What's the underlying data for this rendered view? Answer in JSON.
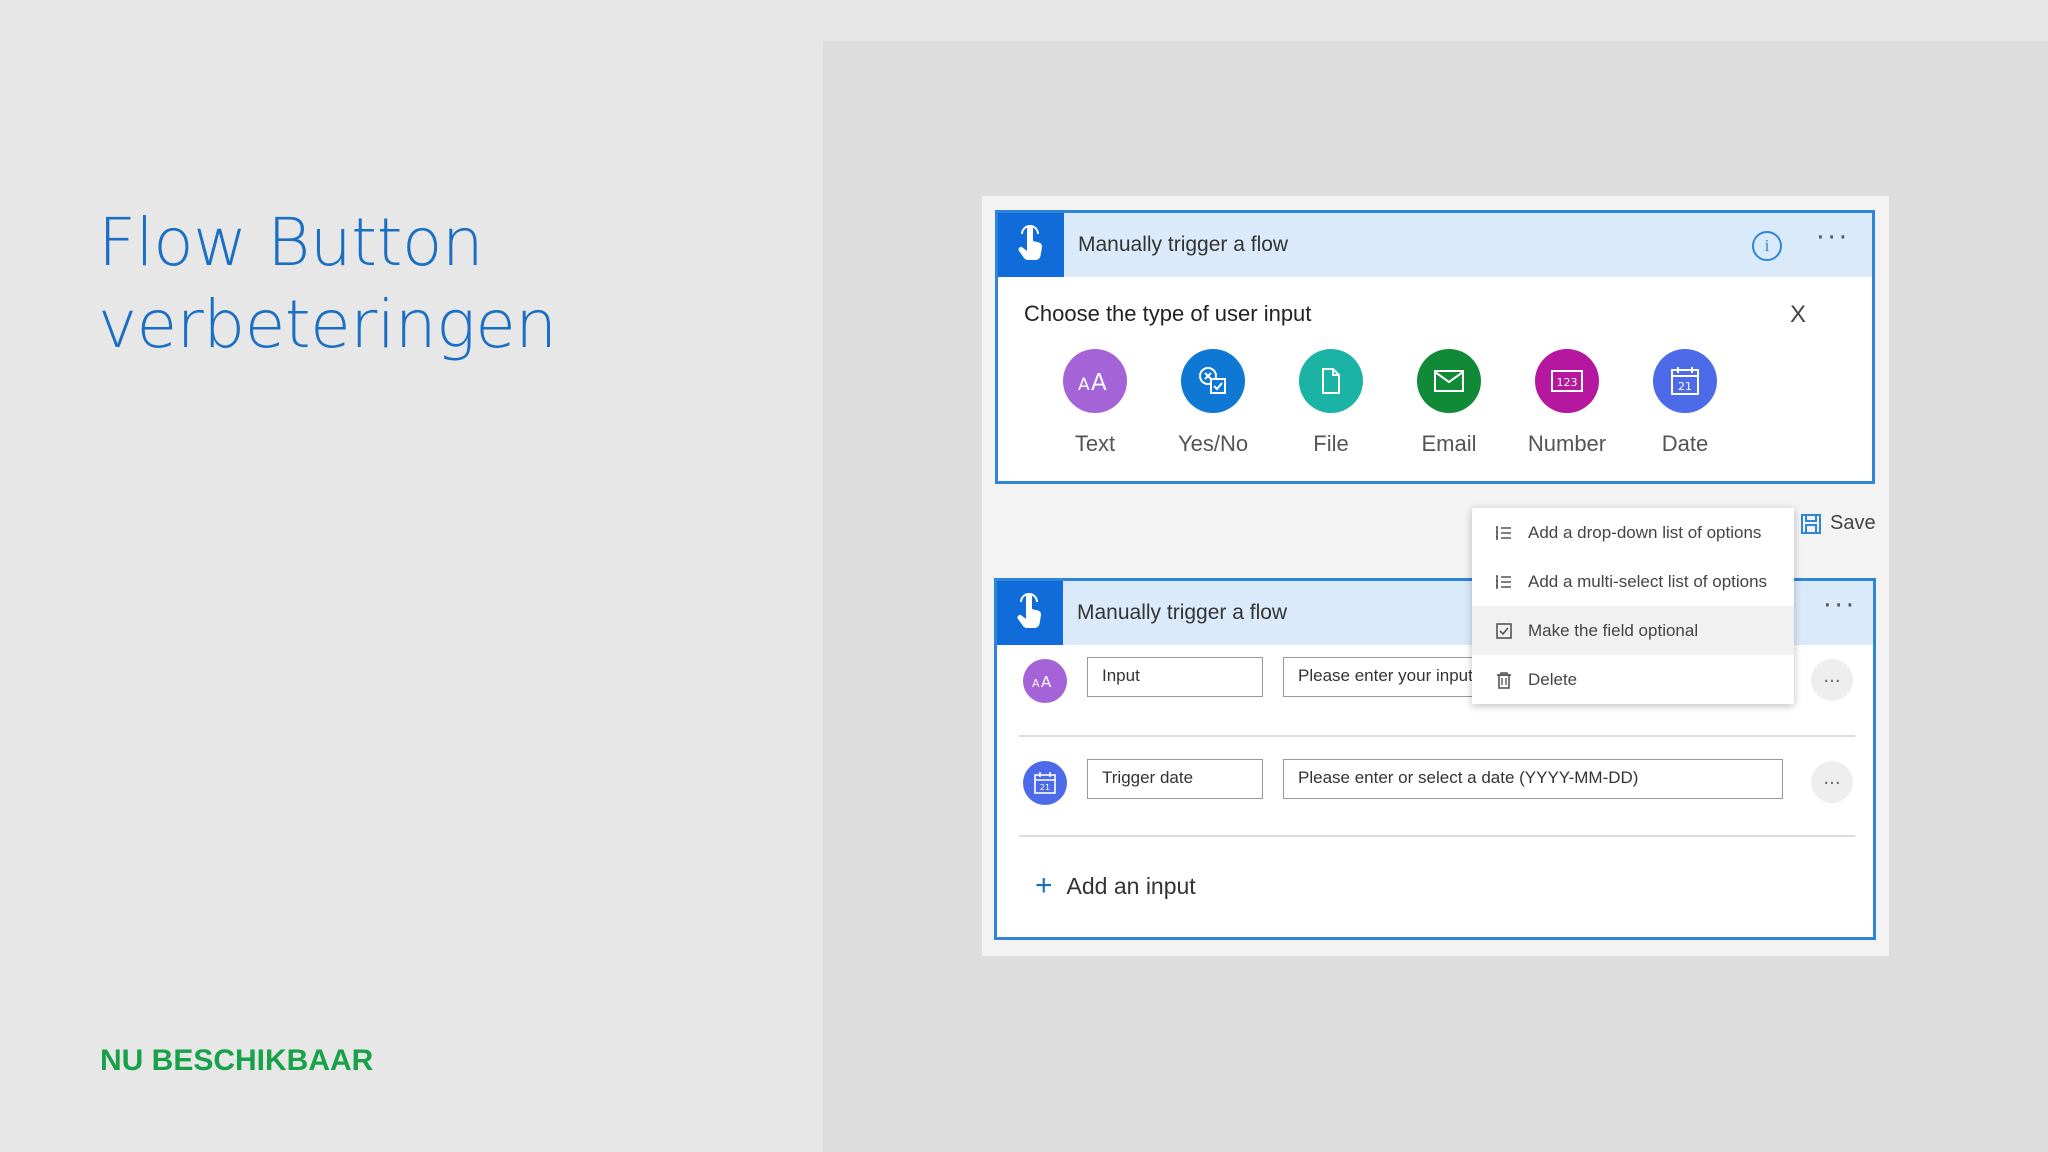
{
  "slide": {
    "title_line1": "Flow Button",
    "title_line2": "verbeteringen",
    "badge": "NU BESCHIKBAAR"
  },
  "trigger_card": {
    "title": "Manually trigger a flow",
    "prompt": "Choose the type of user input",
    "close": "X",
    "input_types": [
      {
        "label": "Text",
        "icon": "text-icon",
        "color": "#a463d6"
      },
      {
        "label": "Yes/No",
        "icon": "yes-no-icon",
        "color": "#0f78d4"
      },
      {
        "label": "File",
        "icon": "file-icon",
        "color": "#1bb3a4"
      },
      {
        "label": "Email",
        "icon": "email-icon",
        "color": "#108a36"
      },
      {
        "label": "Number",
        "icon": "number-icon",
        "color": "#b5179e"
      },
      {
        "label": "Date",
        "icon": "date-icon",
        "color": "#4d6ae8"
      }
    ]
  },
  "toolbar": {
    "save_label": "Save"
  },
  "context_menu": {
    "items": [
      {
        "label": "Add a drop-down list of options",
        "icon": "list-icon"
      },
      {
        "label": "Add a multi-select list of options",
        "icon": "list-icon"
      },
      {
        "label": "Make the field optional",
        "icon": "checkbox-icon"
      },
      {
        "label": "Delete",
        "icon": "trash-icon"
      }
    ]
  },
  "inputs_card": {
    "title": "Manually trigger a flow",
    "rows": [
      {
        "name": "Input",
        "placeholder": "Please enter your input",
        "icon": "text-icon",
        "color": "#a463d6"
      },
      {
        "name": "Trigger date",
        "placeholder": "Please enter or select a date (YYYY-MM-DD)",
        "icon": "date-icon",
        "color": "#4d6ae8"
      }
    ],
    "more": "...",
    "add_input": "Add an input"
  },
  "colors": {
    "accent": "#1a6fc4",
    "trigger_blue": "#0f6cd8",
    "card_border": "#2f86d8",
    "badge_green": "#17a24a"
  }
}
